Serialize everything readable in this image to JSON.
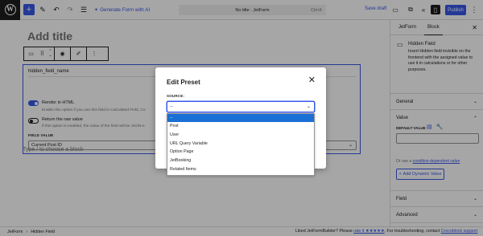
{
  "topbar": {
    "ai_label": "Generate Form with AI",
    "doc_title": "No title · JetForm",
    "shortcut": "Ctrl+K",
    "save_draft": "Save draft",
    "publish": "Publish"
  },
  "editor": {
    "title_placeholder": "Add title",
    "field_name": "hidden_field_name",
    "render_html": {
      "label": "Render in HTML",
      "help": "Enable this option if you use this field in Calculated Field, Co"
    },
    "return_raw": {
      "label": "Return the raw value",
      "help": "If this option is enabled, the value of the field will be JSON-e"
    },
    "field_value_label": "FIELD VALUE",
    "field_value": "Current Post ID",
    "appender_placeholder": "Type / to choose a block"
  },
  "statusbar": {
    "breadcrumb": [
      "JetForm",
      "Hidden Field"
    ],
    "rating_text": "Liked JetFormBuilder? Please ",
    "rating_link": "rate it ★★★★★",
    "rating_suffix": ". For troubleshooting, contact ",
    "support_link": "Crocoblock support"
  },
  "sidebar": {
    "tabs": [
      "JetForm",
      "Block"
    ],
    "block_title": "Hidden Field",
    "block_desc": "Insert Hidden field invisible on the frontend with the assigned value to use it in calculations or for other purposes.",
    "panels": {
      "general": "General",
      "value": "Value",
      "field": "Field",
      "advanced": "Advanced"
    },
    "default_value_label": "DEFAULT VALUE",
    "or_text": "Or use a ",
    "or_link": "condition-dependent value",
    "add_dynamic": "Add Dynamic Value"
  },
  "modal": {
    "title": "Edit Preset",
    "source_label": "SOURCE:",
    "source_value": "--",
    "options": [
      "--",
      "Post",
      "User",
      "URL Query Variable",
      "Option Page",
      "JetBooking",
      "Related Items"
    ],
    "selected_index": 0
  },
  "colors": {
    "accent": "#3858e9",
    "dropdown_highlight": "#1a6fd4",
    "wp_dark": "#1e1e1e"
  }
}
